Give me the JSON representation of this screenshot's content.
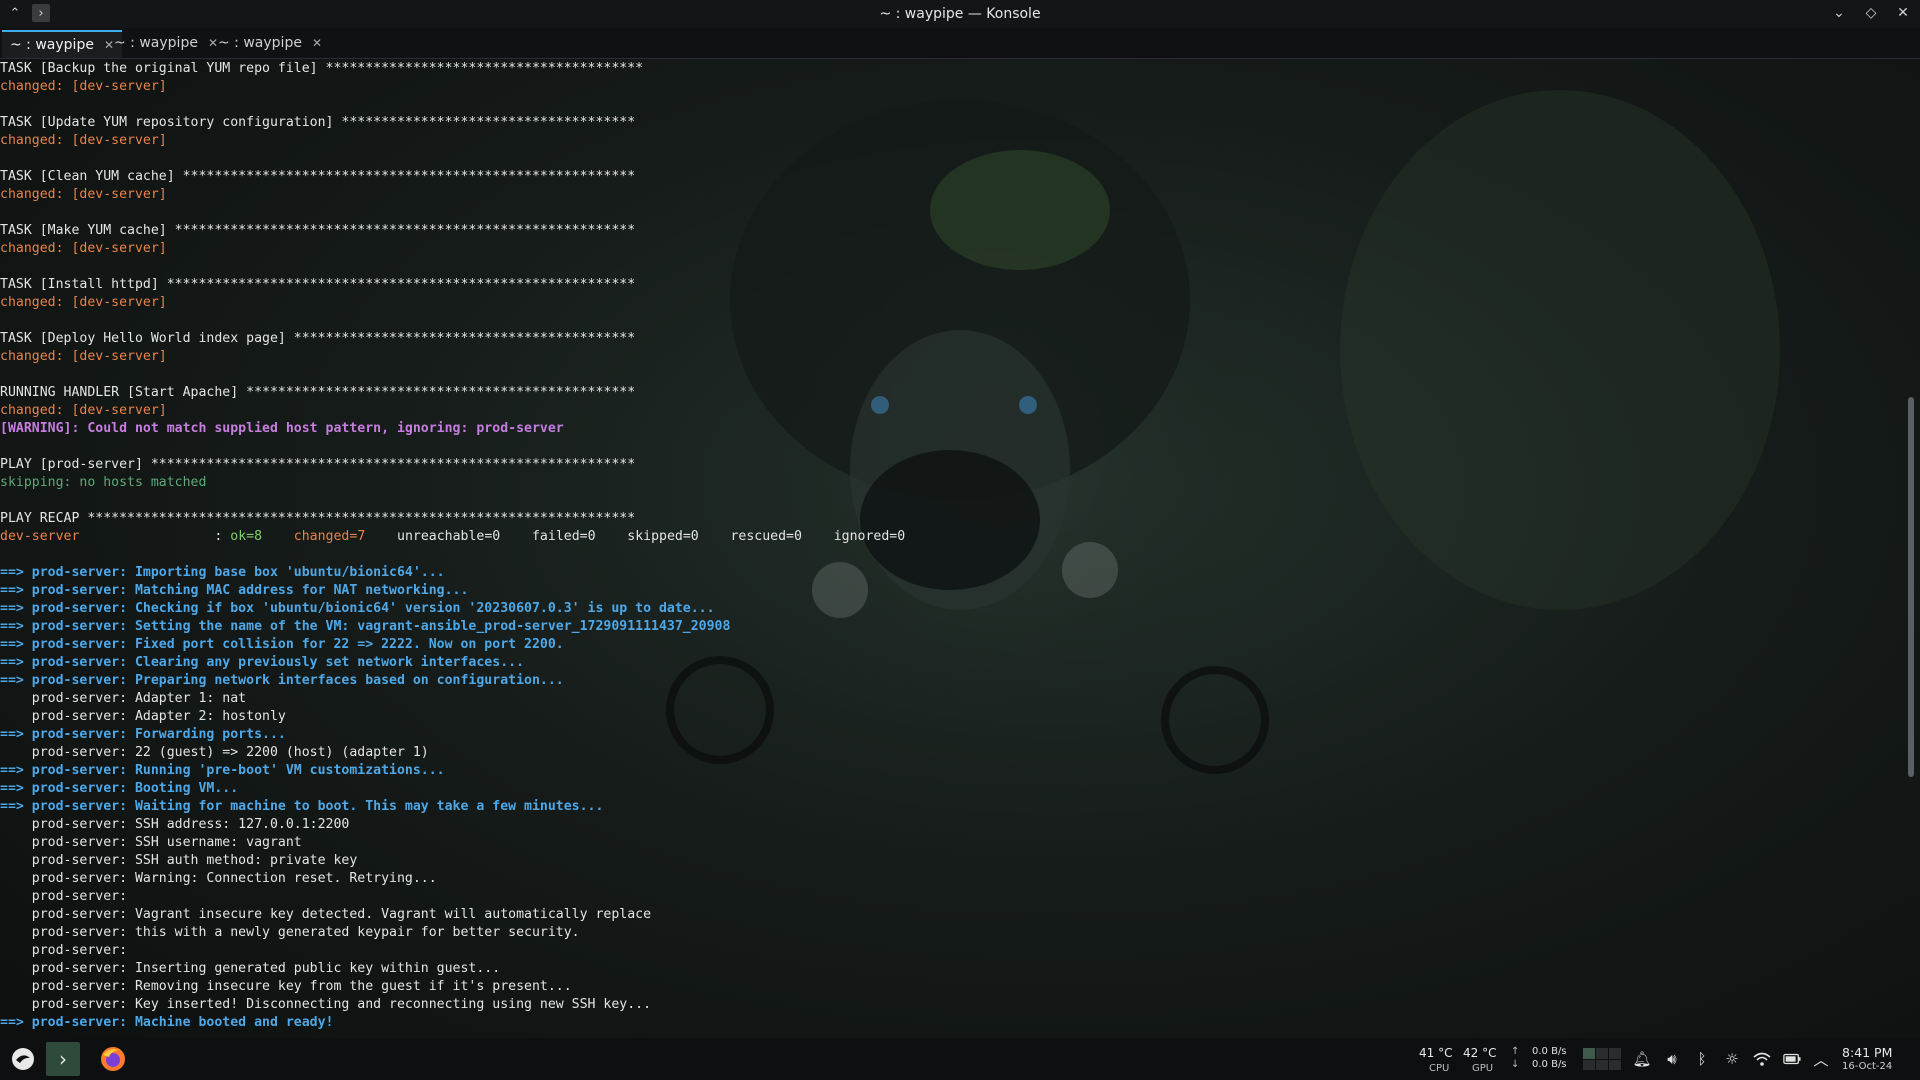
{
  "window": {
    "title": "~ : waypipe — Konsole"
  },
  "tabs": [
    {
      "label": "~ : waypipe",
      "active": true
    },
    {
      "label": "~ : waypipe",
      "active": false
    },
    {
      "label": "~ : waypipe",
      "active": false
    }
  ],
  "terminal_lines": [
    [
      {
        "t": "TASK [Backup the original YUM repo file] ****************************************",
        "c": "white"
      }
    ],
    [
      {
        "t": "changed: [dev-server]",
        "c": "orange"
      }
    ],
    [],
    [
      {
        "t": "TASK [Update YUM repository configuration] *************************************",
        "c": "white"
      }
    ],
    [
      {
        "t": "changed: [dev-server]",
        "c": "orange"
      }
    ],
    [],
    [
      {
        "t": "TASK [Clean YUM cache] *********************************************************",
        "c": "white"
      }
    ],
    [
      {
        "t": "changed: [dev-server]",
        "c": "orange"
      }
    ],
    [],
    [
      {
        "t": "TASK [Make YUM cache] **********************************************************",
        "c": "white"
      }
    ],
    [
      {
        "t": "changed: [dev-server]",
        "c": "orange"
      }
    ],
    [],
    [
      {
        "t": "TASK [Install httpd] ***********************************************************",
        "c": "white"
      }
    ],
    [
      {
        "t": "changed: [dev-server]",
        "c": "orange"
      }
    ],
    [],
    [
      {
        "t": "TASK [Deploy Hello World index page] *******************************************",
        "c": "white"
      }
    ],
    [
      {
        "t": "changed: [dev-server]",
        "c": "orange"
      }
    ],
    [],
    [
      {
        "t": "RUNNING HANDLER [Start Apache] *************************************************",
        "c": "white"
      }
    ],
    [
      {
        "t": "changed: [dev-server]",
        "c": "orange"
      }
    ],
    [
      {
        "t": "[WARNING]: Could not match supplied host pattern, ignoring: prod-server",
        "c": "purple"
      }
    ],
    [],
    [
      {
        "t": "PLAY [prod-server] *************************************************************",
        "c": "white"
      }
    ],
    [
      {
        "t": "skipping: no hosts matched",
        "c": "green"
      }
    ],
    [],
    [
      {
        "t": "PLAY RECAP *********************************************************************",
        "c": "white"
      }
    ],
    [
      {
        "t": "dev-server",
        "c": "orange"
      },
      {
        "t": "                 : ",
        "c": "white"
      },
      {
        "t": "ok=8",
        "c": "okgreen"
      },
      {
        "t": "    ",
        "c": "white"
      },
      {
        "t": "changed=7",
        "c": "orange"
      },
      {
        "t": "    unreachable=0    failed=0    skipped=0    rescued=0    ignored=0",
        "c": "white"
      }
    ],
    [],
    [
      {
        "t": "==> prod-server: Importing base box 'ubuntu/bionic64'...",
        "c": "blue"
      }
    ],
    [
      {
        "t": "==> prod-server: Matching MAC address for NAT networking...",
        "c": "blue"
      }
    ],
    [
      {
        "t": "==> prod-server: Checking if box 'ubuntu/bionic64' version '20230607.0.3' is up to date...",
        "c": "blue"
      }
    ],
    [
      {
        "t": "==> prod-server: Setting the name of the VM: vagrant-ansible_prod-server_1729091111437_20908",
        "c": "blue"
      }
    ],
    [
      {
        "t": "==> prod-server: Fixed port collision for 22 => 2222. Now on port 2200.",
        "c": "blue"
      }
    ],
    [
      {
        "t": "==> prod-server: Clearing any previously set network interfaces...",
        "c": "blue"
      }
    ],
    [
      {
        "t": "==> prod-server: Preparing network interfaces based on configuration...",
        "c": "blue"
      }
    ],
    [
      {
        "t": "    prod-server: Adapter 1: nat",
        "c": "white"
      }
    ],
    [
      {
        "t": "    prod-server: Adapter 2: hostonly",
        "c": "white"
      }
    ],
    [
      {
        "t": "==> prod-server: Forwarding ports...",
        "c": "blue"
      }
    ],
    [
      {
        "t": "    prod-server: 22 (guest) => 2200 (host) (adapter 1)",
        "c": "white"
      }
    ],
    [
      {
        "t": "==> prod-server: Running 'pre-boot' VM customizations...",
        "c": "blue"
      }
    ],
    [
      {
        "t": "==> prod-server: Booting VM...",
        "c": "blue"
      }
    ],
    [
      {
        "t": "==> prod-server: Waiting for machine to boot. This may take a few minutes...",
        "c": "blue"
      }
    ],
    [
      {
        "t": "    prod-server: SSH address: 127.0.0.1:2200",
        "c": "white"
      }
    ],
    [
      {
        "t": "    prod-server: SSH username: vagrant",
        "c": "white"
      }
    ],
    [
      {
        "t": "    prod-server: SSH auth method: private key",
        "c": "white"
      }
    ],
    [
      {
        "t": "    prod-server: Warning: Connection reset. Retrying...",
        "c": "white"
      }
    ],
    [
      {
        "t": "    prod-server:",
        "c": "white"
      }
    ],
    [
      {
        "t": "    prod-server: Vagrant insecure key detected. Vagrant will automatically replace",
        "c": "white"
      }
    ],
    [
      {
        "t": "    prod-server: this with a newly generated keypair for better security.",
        "c": "white"
      }
    ],
    [
      {
        "t": "    prod-server:",
        "c": "white"
      }
    ],
    [
      {
        "t": "    prod-server: Inserting generated public key within guest...",
        "c": "white"
      }
    ],
    [
      {
        "t": "    prod-server: Removing insecure key from the guest if it's present...",
        "c": "white"
      }
    ],
    [
      {
        "t": "    prod-server: Key inserted! Disconnecting and reconnecting using new SSH key...",
        "c": "white"
      }
    ],
    [
      {
        "t": "==> prod-server: Machine booted and ready!",
        "c": "blue"
      }
    ]
  ],
  "taskbar": {
    "cpu_temp": "41 °C",
    "cpu_label": "CPU",
    "gpu_temp": "42 °C",
    "gpu_label": "GPU",
    "net_up": "0.0 B/s",
    "net_down": "0.0 B/s",
    "time": "8:41 PM",
    "date": "16-Oct-24"
  },
  "colors": {
    "accent": "#3daee9",
    "orange": "#e7834a",
    "blue": "#4ea8e8",
    "purple": "#c77de0",
    "green": "#5fa87a"
  },
  "icons": [
    "launcher-icon",
    "terminal-icon",
    "firefox-icon",
    "notifications-icon",
    "volume-icon",
    "bluetooth-icon",
    "brightness-icon",
    "wifi-icon",
    "battery-icon",
    "tray-expand-icon"
  ]
}
